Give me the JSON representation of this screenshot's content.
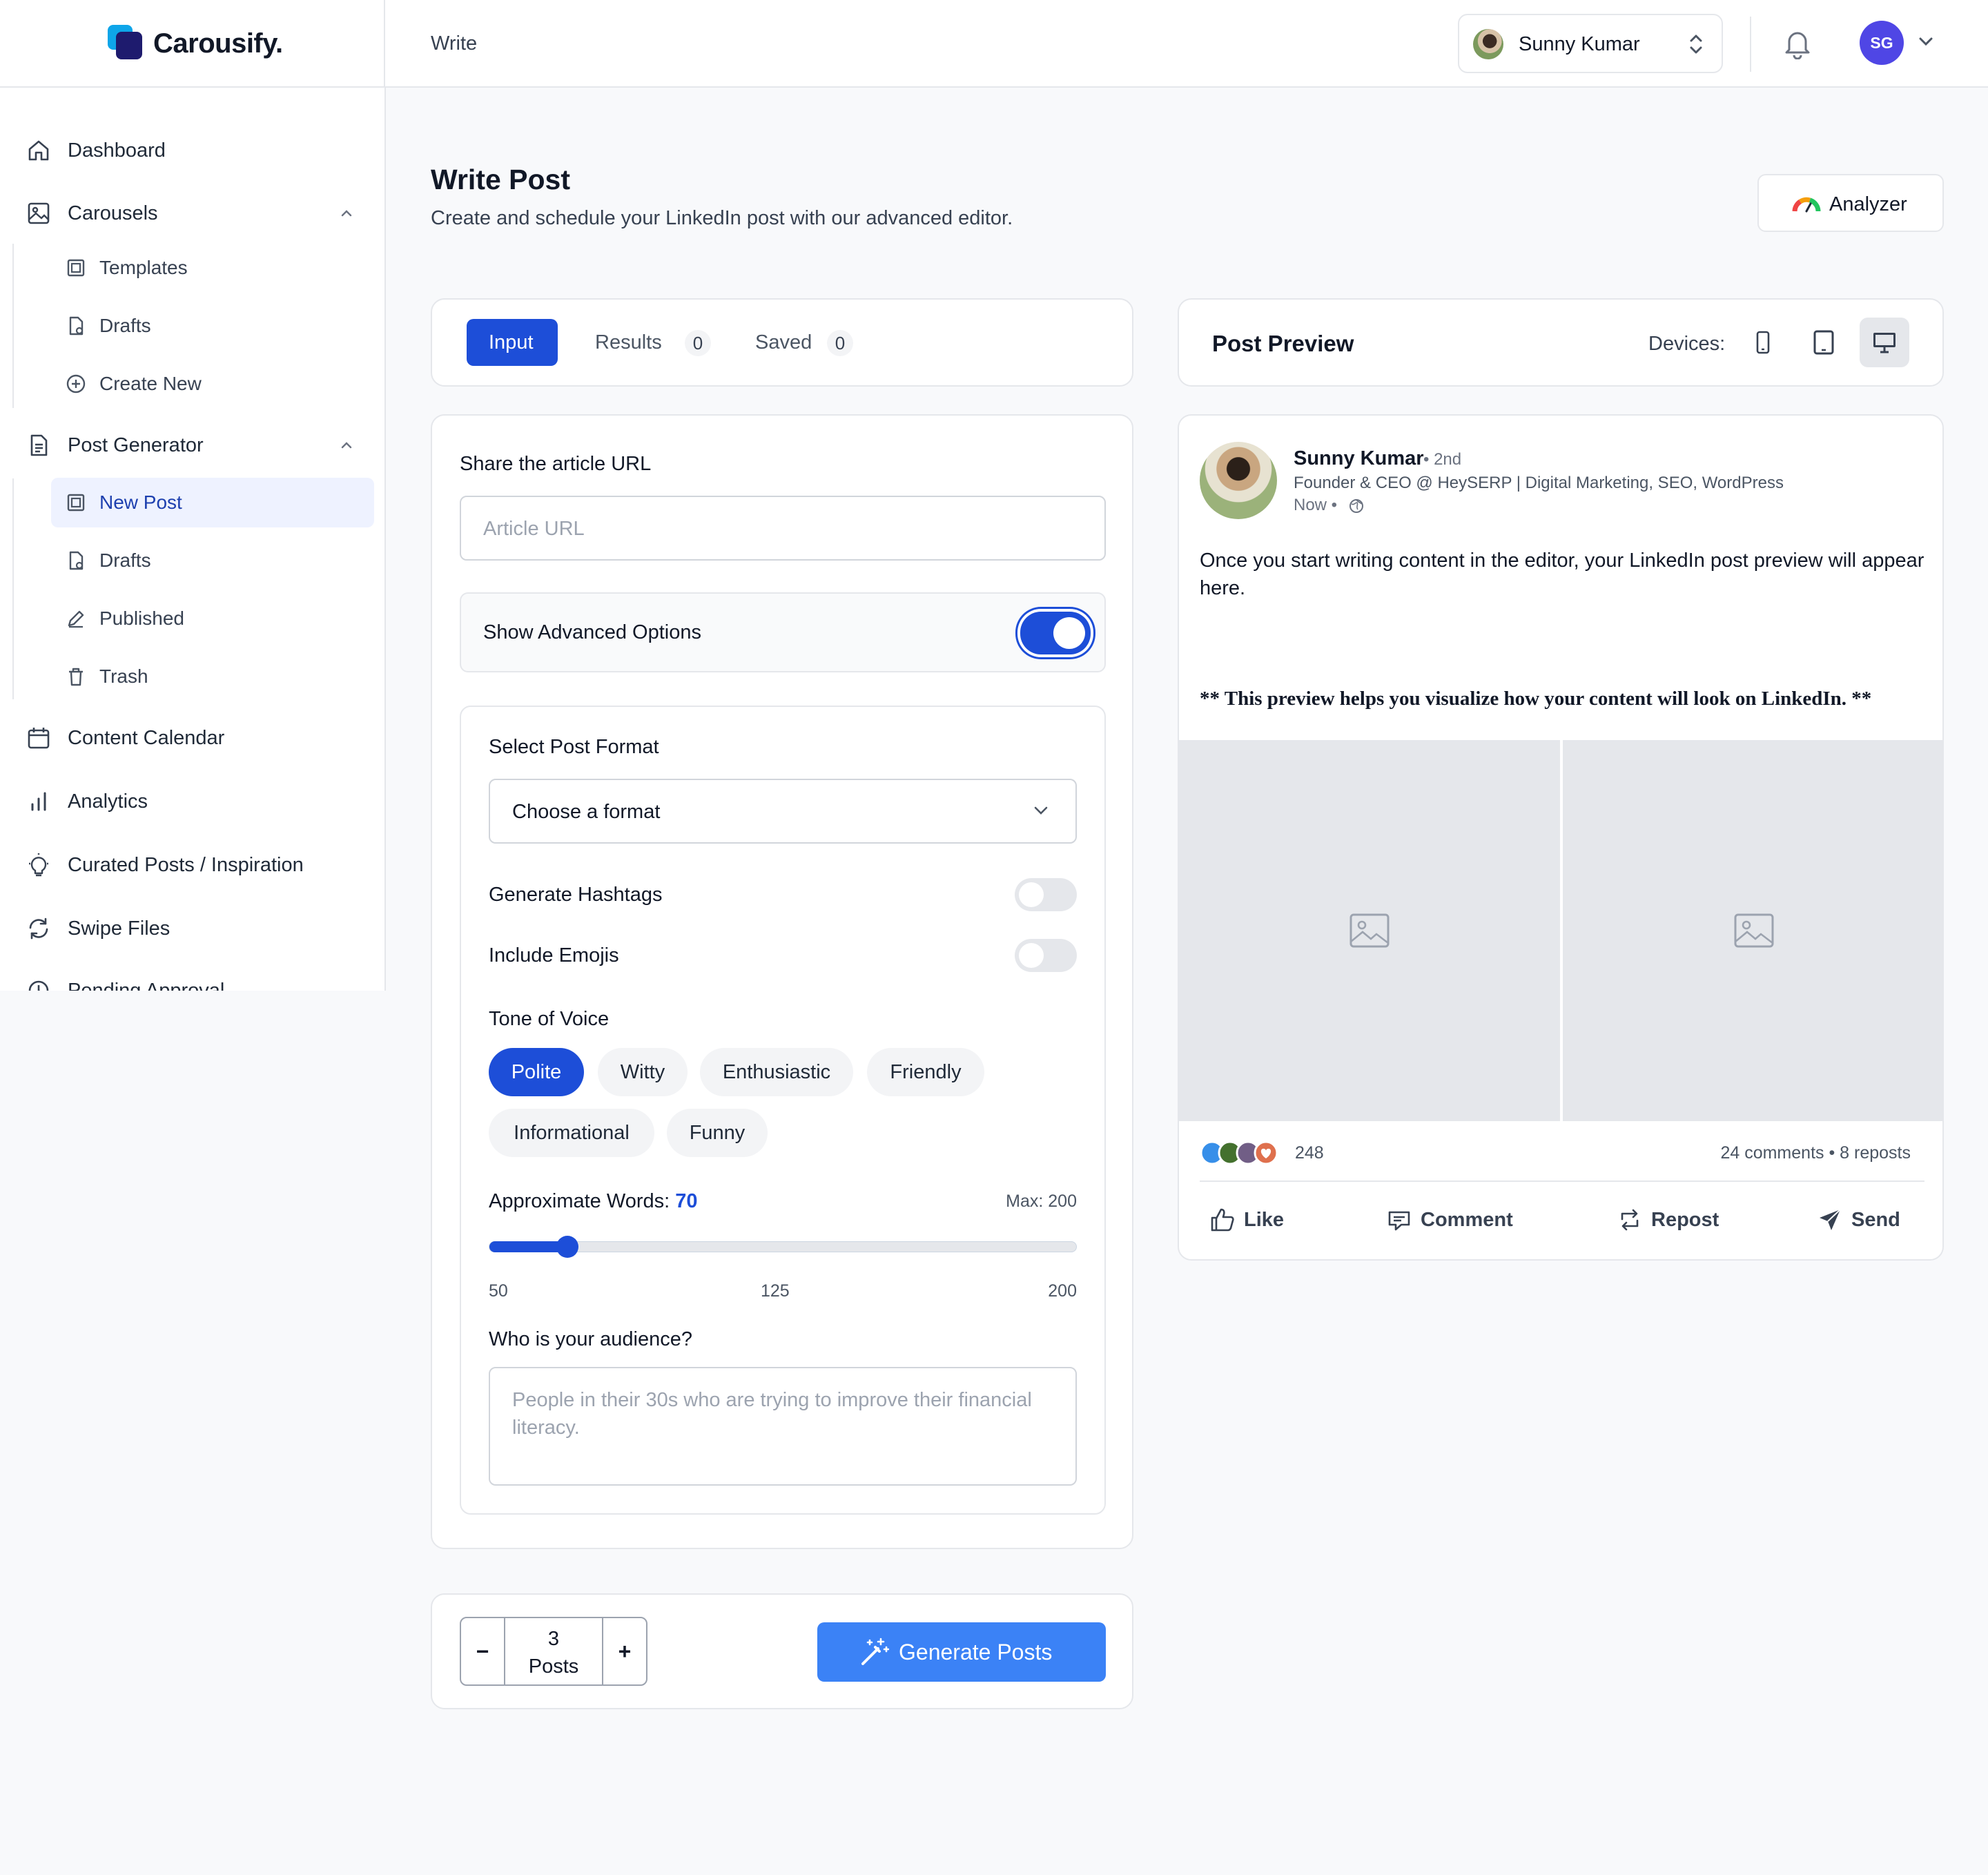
{
  "app": {
    "name": "Carousify."
  },
  "header": {
    "breadcrumb": "Write",
    "account_name": "Sunny Kumar",
    "user_initials": "SG"
  },
  "sidebar": {
    "items": [
      {
        "label": "Dashboard",
        "icon": "home-icon"
      },
      {
        "label": "Carousels",
        "icon": "image-icon",
        "expanded": true,
        "children": [
          {
            "label": "Templates",
            "icon": "template-icon"
          },
          {
            "label": "Drafts",
            "icon": "draft-icon"
          },
          {
            "label": "Create New",
            "icon": "plus-circle-icon"
          }
        ]
      },
      {
        "label": "Post Generator",
        "icon": "document-icon",
        "expanded": true,
        "children": [
          {
            "label": "New Post",
            "icon": "template-icon",
            "active": true
          },
          {
            "label": "Drafts",
            "icon": "draft-icon"
          },
          {
            "label": "Published",
            "icon": "pen-icon"
          },
          {
            "label": "Trash",
            "icon": "trash-icon"
          }
        ]
      },
      {
        "label": "Content Calendar",
        "icon": "calendar-icon"
      },
      {
        "label": "Analytics",
        "icon": "bar-chart-icon"
      },
      {
        "label": "Curated Posts / Inspiration",
        "icon": "lightbulb-icon"
      },
      {
        "label": "Swipe Files",
        "icon": "refresh-icon"
      },
      {
        "label": "Pending Approval",
        "icon": "clock-icon"
      }
    ]
  },
  "page": {
    "title": "Write Post",
    "subtitle": "Create and schedule your LinkedIn post with our advanced editor.",
    "analyzer_label": "Analyzer"
  },
  "tabs": [
    {
      "label": "Input",
      "active": true
    },
    {
      "label": "Results",
      "count": "0"
    },
    {
      "label": "Saved",
      "count": "0"
    }
  ],
  "form": {
    "url_label": "Share the article URL",
    "url_placeholder": "Article URL",
    "url_value": "",
    "advanced_label": "Show Advanced Options",
    "advanced_on": true,
    "format_label": "Select Post Format",
    "format_value": "Choose a format",
    "hashtags_label": "Generate Hashtags",
    "hashtags_on": false,
    "emojis_label": "Include Emojis",
    "emojis_on": false,
    "tone_label": "Tone of Voice",
    "tones": [
      "Polite",
      "Witty",
      "Enthusiastic",
      "Friendly",
      "Informational",
      "Funny"
    ],
    "tone_selected": "Polite",
    "words_label": "Approximate Words:",
    "words_value": "70",
    "words_max_label": "Max: 200",
    "slider": {
      "min": 50,
      "max": 200,
      "value": 70,
      "ticks": [
        "50",
        "125",
        "200"
      ]
    },
    "audience_label": "Who is your audience?",
    "audience_placeholder": "People in their 30s who are trying to improve their financial literacy."
  },
  "generator": {
    "post_count": "3",
    "post_unit": "Posts",
    "minus": "−",
    "plus": "+",
    "button_label": "Generate Posts"
  },
  "preview": {
    "title": "Post Preview",
    "devices_label": "Devices:",
    "devices": [
      "mobile-icon",
      "tablet-icon",
      "desktop-icon"
    ],
    "active_device": "desktop-icon",
    "post": {
      "author": "Sunny Kumar",
      "degree": "• 2nd",
      "headline": "Founder & CEO @ HeySERP | Digital Marketing, SEO, WordPress",
      "time": "Now •",
      "body": "Once you start writing content in the editor, your LinkedIn post preview will appear here.",
      "note": "** This preview helps you visualize how your content will look on LinkedIn. **",
      "reactions_count": "248",
      "stats": "24 comments  •  8 reposts",
      "actions": [
        "Like",
        "Comment",
        "Repost",
        "Send"
      ]
    }
  },
  "colors": {
    "primary": "#1d4ed8",
    "button": "#3b82f6",
    "avatar": "#4f46e5",
    "active_nav_bg": "#eef2ff"
  }
}
